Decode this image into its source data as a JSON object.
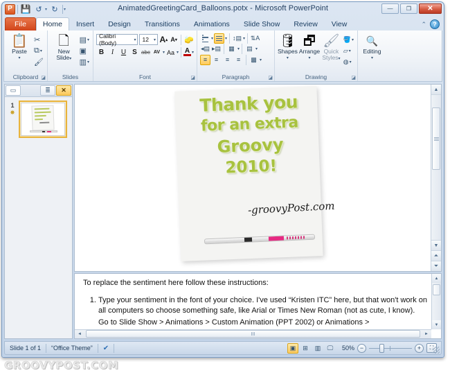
{
  "window": {
    "title": "AnimatedGreetingCard_Balloons.potx - Microsoft PowerPoint",
    "app_logo": "P",
    "minimize": "—",
    "maximize": "❐",
    "close": "✕"
  },
  "quick_access": {
    "save": "save-icon",
    "undo": "↺",
    "redo": "↻",
    "customize": "▾"
  },
  "tabs": [
    {
      "label": "File",
      "active": false,
      "kind": "file"
    },
    {
      "label": "Home",
      "active": true,
      "kind": "normal"
    },
    {
      "label": "Insert",
      "active": false,
      "kind": "normal"
    },
    {
      "label": "Design",
      "active": false,
      "kind": "normal"
    },
    {
      "label": "Transitions",
      "active": false,
      "kind": "normal"
    },
    {
      "label": "Animations",
      "active": false,
      "kind": "normal"
    },
    {
      "label": "Slide Show",
      "active": false,
      "kind": "normal"
    },
    {
      "label": "Review",
      "active": false,
      "kind": "normal"
    },
    {
      "label": "View",
      "active": false,
      "kind": "normal"
    }
  ],
  "tab_help": {
    "minimize_ribbon": "⌃",
    "help": "?"
  },
  "ribbon": {
    "clipboard": {
      "name": "Clipboard",
      "paste": "Paste",
      "cut": "✂",
      "copy": "⧉",
      "format_painter": "🖌"
    },
    "slides": {
      "name": "Slides",
      "new_slide": "New\nSlide",
      "new_slide_line1": "New",
      "new_slide_line2": "Slide",
      "layout": "▤",
      "reset": "▣",
      "section": "▥"
    },
    "font": {
      "name": "Font",
      "font_name": "Calibri (Body)",
      "font_size": "12",
      "grow": "A",
      "shrink": "A",
      "clear_formatting": "✦",
      "bold": "B",
      "italic": "I",
      "underline": "U",
      "shadow": "S",
      "strikethrough": "abc",
      "character_spacing": "AV",
      "change_case": "Aa",
      "font_color": "A"
    },
    "paragraph": {
      "name": "Paragraph",
      "bullets": "bullets-icon",
      "numbering": "numbering-icon",
      "decrease_indent": "◂▤",
      "increase_indent": "▸▤",
      "line_spacing": "↕▤",
      "text_direction": "⇅A",
      "columns": "▦",
      "align_text": "▤",
      "align_left": "≡",
      "align_center": "≡",
      "align_right": "≡",
      "justify": "≡",
      "convert_smartart": "▩"
    },
    "drawing": {
      "name": "Drawing",
      "shapes": "Shapes",
      "arrange": "Arrange",
      "quick_styles_line1": "Quick",
      "quick_styles_line2": "Styles",
      "shape_fill": "🪣",
      "shape_outline": "▱",
      "shape_effects": "◍"
    },
    "editing": {
      "name": "Editing",
      "label": "Editing",
      "icon": "🔍"
    }
  },
  "thumbnail_pane": {
    "tab_slides": "▭",
    "tab_outline": "≣",
    "close": "✕",
    "slides": [
      {
        "number": "1",
        "animation_marker": "✵"
      }
    ]
  },
  "slide": {
    "lines": [
      "Thank you",
      "for an extra",
      "Groovy",
      "2010!"
    ],
    "signature": "-groovyPost.com",
    "text_color": "#a8c23f"
  },
  "slide_scroll": {
    "up": "▲",
    "down": "▼",
    "prev_slide": "⏫",
    "next_slide": "⏬"
  },
  "notes": {
    "intro": "To replace the sentiment here follow these instructions:",
    "items": [
      "Type your sentiment in the font of your choice. I've used “Kristen ITC” here, but that won't work on all computers so choose something safe, like Arial or Times New Roman (not as cute, I know).",
      "Go to Slide Show > Animations > Custom Animation (PPT 2002) or Animations >"
    ],
    "scroll_up": "▲",
    "scroll_down": "▼",
    "scroll_left": "◄",
    "scroll_right": "►"
  },
  "status_bar": {
    "slide_count": "Slide 1 of 1",
    "theme": "“Office Theme”",
    "spellcheck": "spellcheck-icon",
    "views": [
      {
        "name": "normal",
        "glyph": "▣",
        "active": true
      },
      {
        "name": "slide-sorter",
        "glyph": "⊞",
        "active": false
      },
      {
        "name": "reading-view",
        "glyph": "▥",
        "active": false
      },
      {
        "name": "slide-show",
        "glyph": "🖵",
        "active": false
      }
    ],
    "zoom_level": "50%",
    "zoom_out": "−",
    "zoom_in": "+",
    "fit_to_window": "⛶"
  },
  "watermark": "GROOVYPOST.COM"
}
